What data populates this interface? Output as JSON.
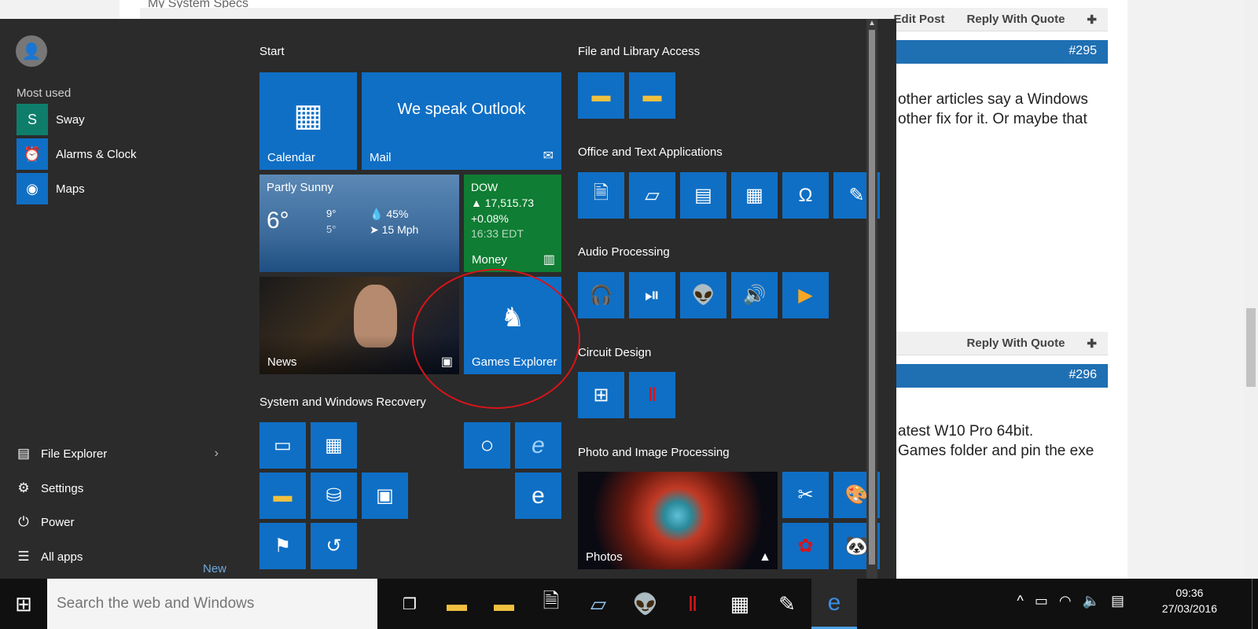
{
  "background": {
    "specs_link": "My System Specs",
    "actions_top": [
      "Edit Post",
      "Reply With Quote"
    ],
    "post1_number": "#295",
    "post1_text": [
      "other articles say a Windows",
      "other fix for it. Or maybe that"
    ],
    "actions_mid": [
      "Reply With Quote"
    ],
    "post2_number": "#296",
    "post2_text": [
      "atest W10 Pro 64bit.",
      "Games folder and pin the exe"
    ]
  },
  "start_menu": {
    "most_used_title": "Most used",
    "most_used": [
      {
        "label": "Sway",
        "icon": "sway-icon",
        "color": "#0e7e6b",
        "glyph": "S"
      },
      {
        "label": "Alarms & Clock",
        "icon": "alarm-clock-icon",
        "color": "#0f6fc5",
        "glyph": "⏰"
      },
      {
        "label": "Maps",
        "icon": "maps-icon",
        "color": "#0f6fc5",
        "glyph": "◉"
      }
    ],
    "bottom": [
      {
        "label": "File Explorer",
        "icon": "folder-icon",
        "glyph": "▤"
      },
      {
        "label": "Settings",
        "icon": "gear-icon",
        "glyph": "⚙"
      },
      {
        "label": "Power",
        "icon": "power-icon",
        "glyph": "⏻"
      },
      {
        "label": "All apps",
        "icon": "all-apps-icon",
        "glyph": "☰"
      }
    ],
    "new_label": "New",
    "groups": {
      "start": "Start",
      "file_library": "File and Library Access",
      "office": "Office and Text Applications",
      "audio": "Audio Processing",
      "circuit": "Circuit Design",
      "photo": "Photo and Image Processing",
      "system": "System and Windows Recovery"
    },
    "tiles": {
      "calendar": "Calendar",
      "mail_heading": "We speak Outlook",
      "mail": "Mail",
      "weather": {
        "condition": "Partly Sunny",
        "temp": "6°",
        "high": "9°",
        "low": "5°",
        "humidity": "45%",
        "wind": "15 Mph"
      },
      "money": {
        "index": "DOW",
        "value": "▲ 17,515.73",
        "change": "+0.08%",
        "time": "16:33 EDT",
        "label": "Money"
      },
      "news": "News",
      "games_explorer": "Games Explorer",
      "photos": "Photos"
    }
  },
  "taskbar": {
    "search_placeholder": "Search the web and Windows",
    "time": "09:36",
    "date": "27/03/2016"
  },
  "colors": {
    "tile_blue": "#0f6fc5",
    "money_green": "#0f7d33",
    "annotation_red": "#d8141a"
  }
}
